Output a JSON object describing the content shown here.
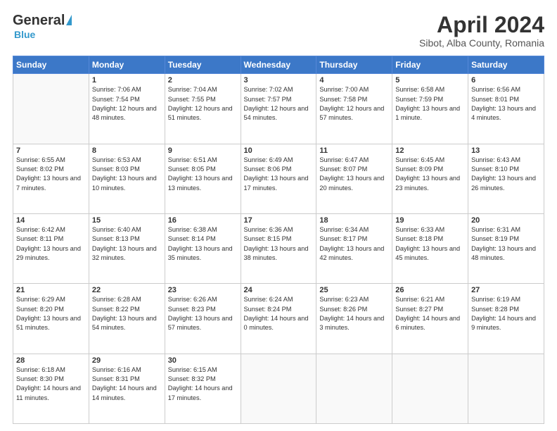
{
  "header": {
    "logo_general": "General",
    "logo_blue": "Blue",
    "month": "April 2024",
    "location": "Sibot, Alba County, Romania"
  },
  "weekdays": [
    "Sunday",
    "Monday",
    "Tuesday",
    "Wednesday",
    "Thursday",
    "Friday",
    "Saturday"
  ],
  "weeks": [
    [
      {
        "day": "",
        "sunrise": "",
        "sunset": "",
        "daylight": ""
      },
      {
        "day": "1",
        "sunrise": "Sunrise: 7:06 AM",
        "sunset": "Sunset: 7:54 PM",
        "daylight": "Daylight: 12 hours and 48 minutes."
      },
      {
        "day": "2",
        "sunrise": "Sunrise: 7:04 AM",
        "sunset": "Sunset: 7:55 PM",
        "daylight": "Daylight: 12 hours and 51 minutes."
      },
      {
        "day": "3",
        "sunrise": "Sunrise: 7:02 AM",
        "sunset": "Sunset: 7:57 PM",
        "daylight": "Daylight: 12 hours and 54 minutes."
      },
      {
        "day": "4",
        "sunrise": "Sunrise: 7:00 AM",
        "sunset": "Sunset: 7:58 PM",
        "daylight": "Daylight: 12 hours and 57 minutes."
      },
      {
        "day": "5",
        "sunrise": "Sunrise: 6:58 AM",
        "sunset": "Sunset: 7:59 PM",
        "daylight": "Daylight: 13 hours and 1 minute."
      },
      {
        "day": "6",
        "sunrise": "Sunrise: 6:56 AM",
        "sunset": "Sunset: 8:01 PM",
        "daylight": "Daylight: 13 hours and 4 minutes."
      }
    ],
    [
      {
        "day": "7",
        "sunrise": "Sunrise: 6:55 AM",
        "sunset": "Sunset: 8:02 PM",
        "daylight": "Daylight: 13 hours and 7 minutes."
      },
      {
        "day": "8",
        "sunrise": "Sunrise: 6:53 AM",
        "sunset": "Sunset: 8:03 PM",
        "daylight": "Daylight: 13 hours and 10 minutes."
      },
      {
        "day": "9",
        "sunrise": "Sunrise: 6:51 AM",
        "sunset": "Sunset: 8:05 PM",
        "daylight": "Daylight: 13 hours and 13 minutes."
      },
      {
        "day": "10",
        "sunrise": "Sunrise: 6:49 AM",
        "sunset": "Sunset: 8:06 PM",
        "daylight": "Daylight: 13 hours and 17 minutes."
      },
      {
        "day": "11",
        "sunrise": "Sunrise: 6:47 AM",
        "sunset": "Sunset: 8:07 PM",
        "daylight": "Daylight: 13 hours and 20 minutes."
      },
      {
        "day": "12",
        "sunrise": "Sunrise: 6:45 AM",
        "sunset": "Sunset: 8:09 PM",
        "daylight": "Daylight: 13 hours and 23 minutes."
      },
      {
        "day": "13",
        "sunrise": "Sunrise: 6:43 AM",
        "sunset": "Sunset: 8:10 PM",
        "daylight": "Daylight: 13 hours and 26 minutes."
      }
    ],
    [
      {
        "day": "14",
        "sunrise": "Sunrise: 6:42 AM",
        "sunset": "Sunset: 8:11 PM",
        "daylight": "Daylight: 13 hours and 29 minutes."
      },
      {
        "day": "15",
        "sunrise": "Sunrise: 6:40 AM",
        "sunset": "Sunset: 8:13 PM",
        "daylight": "Daylight: 13 hours and 32 minutes."
      },
      {
        "day": "16",
        "sunrise": "Sunrise: 6:38 AM",
        "sunset": "Sunset: 8:14 PM",
        "daylight": "Daylight: 13 hours and 35 minutes."
      },
      {
        "day": "17",
        "sunrise": "Sunrise: 6:36 AM",
        "sunset": "Sunset: 8:15 PM",
        "daylight": "Daylight: 13 hours and 38 minutes."
      },
      {
        "day": "18",
        "sunrise": "Sunrise: 6:34 AM",
        "sunset": "Sunset: 8:17 PM",
        "daylight": "Daylight: 13 hours and 42 minutes."
      },
      {
        "day": "19",
        "sunrise": "Sunrise: 6:33 AM",
        "sunset": "Sunset: 8:18 PM",
        "daylight": "Daylight: 13 hours and 45 minutes."
      },
      {
        "day": "20",
        "sunrise": "Sunrise: 6:31 AM",
        "sunset": "Sunset: 8:19 PM",
        "daylight": "Daylight: 13 hours and 48 minutes."
      }
    ],
    [
      {
        "day": "21",
        "sunrise": "Sunrise: 6:29 AM",
        "sunset": "Sunset: 8:20 PM",
        "daylight": "Daylight: 13 hours and 51 minutes."
      },
      {
        "day": "22",
        "sunrise": "Sunrise: 6:28 AM",
        "sunset": "Sunset: 8:22 PM",
        "daylight": "Daylight: 13 hours and 54 minutes."
      },
      {
        "day": "23",
        "sunrise": "Sunrise: 6:26 AM",
        "sunset": "Sunset: 8:23 PM",
        "daylight": "Daylight: 13 hours and 57 minutes."
      },
      {
        "day": "24",
        "sunrise": "Sunrise: 6:24 AM",
        "sunset": "Sunset: 8:24 PM",
        "daylight": "Daylight: 14 hours and 0 minutes."
      },
      {
        "day": "25",
        "sunrise": "Sunrise: 6:23 AM",
        "sunset": "Sunset: 8:26 PM",
        "daylight": "Daylight: 14 hours and 3 minutes."
      },
      {
        "day": "26",
        "sunrise": "Sunrise: 6:21 AM",
        "sunset": "Sunset: 8:27 PM",
        "daylight": "Daylight: 14 hours and 6 minutes."
      },
      {
        "day": "27",
        "sunrise": "Sunrise: 6:19 AM",
        "sunset": "Sunset: 8:28 PM",
        "daylight": "Daylight: 14 hours and 9 minutes."
      }
    ],
    [
      {
        "day": "28",
        "sunrise": "Sunrise: 6:18 AM",
        "sunset": "Sunset: 8:30 PM",
        "daylight": "Daylight: 14 hours and 11 minutes."
      },
      {
        "day": "29",
        "sunrise": "Sunrise: 6:16 AM",
        "sunset": "Sunset: 8:31 PM",
        "daylight": "Daylight: 14 hours and 14 minutes."
      },
      {
        "day": "30",
        "sunrise": "Sunrise: 6:15 AM",
        "sunset": "Sunset: 8:32 PM",
        "daylight": "Daylight: 14 hours and 17 minutes."
      },
      {
        "day": "",
        "sunrise": "",
        "sunset": "",
        "daylight": ""
      },
      {
        "day": "",
        "sunrise": "",
        "sunset": "",
        "daylight": ""
      },
      {
        "day": "",
        "sunrise": "",
        "sunset": "",
        "daylight": ""
      },
      {
        "day": "",
        "sunrise": "",
        "sunset": "",
        "daylight": ""
      }
    ]
  ]
}
